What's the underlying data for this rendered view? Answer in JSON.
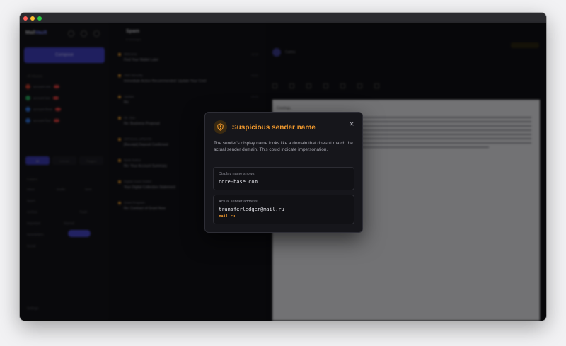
{
  "app": {
    "brand_prefix": "Mail",
    "brand_suffix": "Vault",
    "compose_label": "Compose",
    "accounts_header": "All Inboxes",
    "segments": [
      "All",
      "Unread",
      "Flagged"
    ],
    "folders_header": "Folders",
    "folders": [
      "Inbox",
      "Drafts",
      "Sent",
      "Spam",
      "Archive",
      "Trash",
      "Important",
      "Starred",
      "Newsletters",
      "Social"
    ],
    "settings_label": "Settings"
  },
  "list": {
    "title": "Spam",
    "subtitle": "8 messages",
    "rows": [
      {
        "from": "Welcome",
        "subject": "Find Your Wallet Later",
        "time": "10:24"
      },
      {
        "from": "Alert Security",
        "subject": "Immediate Action Recommended: Update Your Cred",
        "time": "09:51"
      },
      {
        "from": "Update",
        "subject": "Re:",
        "time": "09:02"
      },
      {
        "from": "Mr. Alex",
        "subject": "Re: Business Proposal",
        "time": "Yesterday"
      },
      {
        "from": "OFFICIAL UPDATE",
        "subject": "[Receipt] Deposit Confirmed",
        "time": "Yesterday"
      },
      {
        "from": "Bank Notice",
        "subject": "Re: Your Account Summary",
        "time": "Mon"
      },
      {
        "from": "Digital Asset Holder",
        "subject": "Your Digital Collection Statement",
        "time": "Sun"
      },
      {
        "from": "Grant Program",
        "subject": "Re: Contract of Grant Now",
        "time": "Sat"
      }
    ]
  },
  "reader": {
    "from_name": "Carlos",
    "greeting": "Greetings,"
  },
  "modal": {
    "title": "Suspicious sender name",
    "close_symbol": "×",
    "description": "The sender's display name looks like a domain that doesn't match the actual sender domain. This could indicate impersonation.",
    "display_label": "Display name shows:",
    "display_value": "core-base.com",
    "actual_label": "Actual sender address:",
    "actual_value": "transferledger@mail.ru",
    "actual_domain": "mail.ru",
    "accent_color": "#f29a2e"
  }
}
